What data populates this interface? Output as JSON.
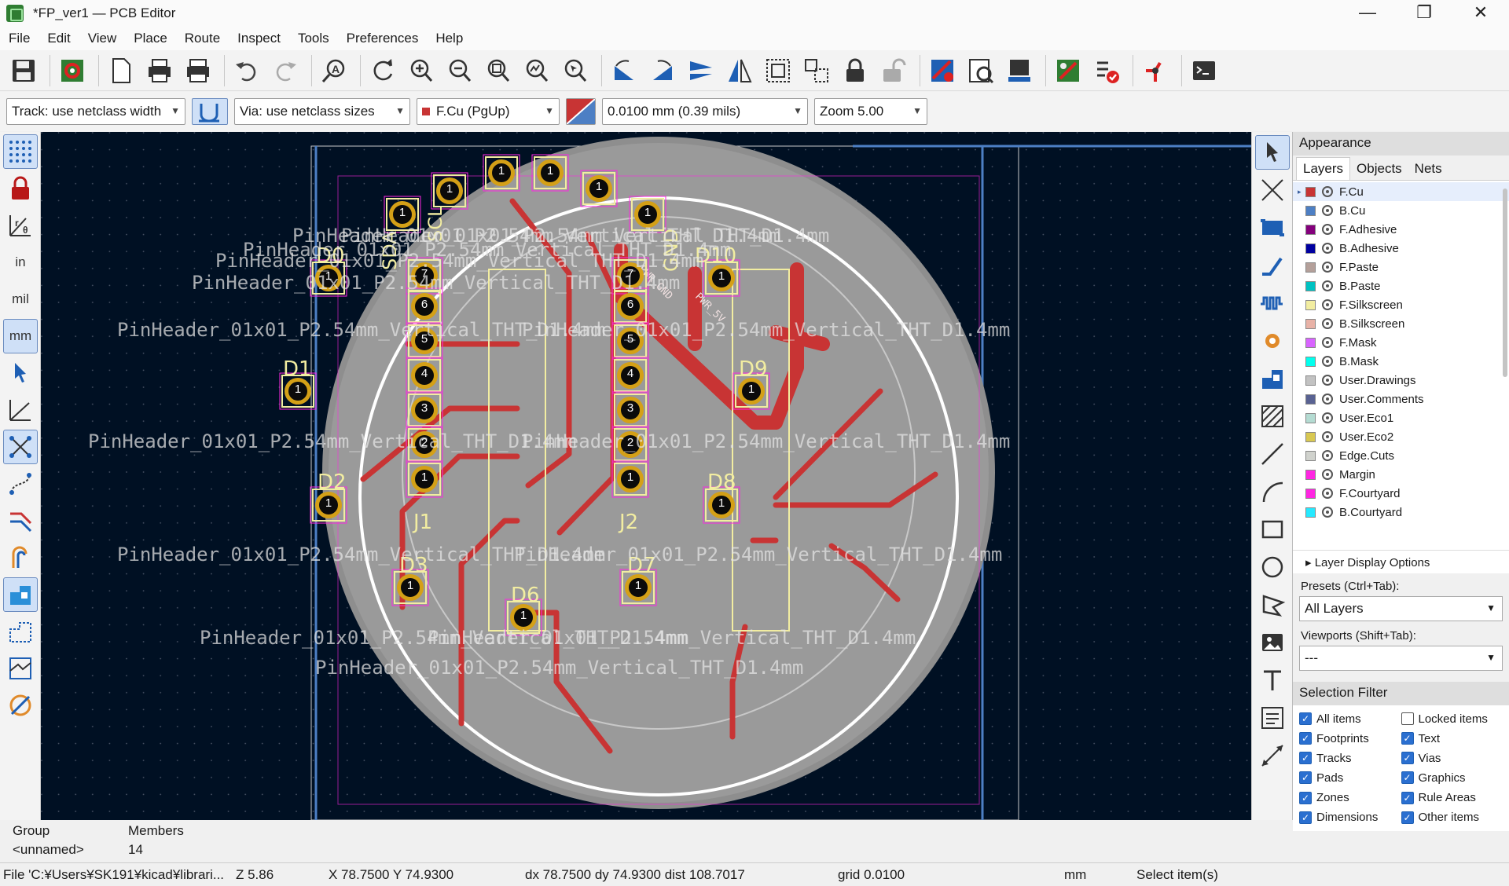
{
  "window": {
    "title": "*FP_ver1 — PCB Editor",
    "controls": [
      "—",
      "❐",
      "✕"
    ]
  },
  "menu": [
    "File",
    "Edit",
    "View",
    "Place",
    "Route",
    "Inspect",
    "Tools",
    "Preferences",
    "Help"
  ],
  "toolbar2": {
    "track": "Track: use netclass width",
    "via": "Via: use netclass sizes",
    "layer": "F.Cu (PgUp)",
    "grid": "0.0100 mm (0.39 mils)",
    "zoom": "Zoom 5.00"
  },
  "lefttools": {
    "in_label": "in",
    "mil_label": "mil",
    "mm_label": "mm"
  },
  "appearance": {
    "title": "Appearance",
    "tabs": [
      "Layers",
      "Objects",
      "Nets"
    ],
    "layers": [
      {
        "name": "F.Cu",
        "color": "#c83434"
      },
      {
        "name": "B.Cu",
        "color": "#4d7fc4"
      },
      {
        "name": "F.Adhesive",
        "color": "#84007c"
      },
      {
        "name": "B.Adhesive",
        "color": "#0000a0"
      },
      {
        "name": "F.Paste",
        "color": "#b4a09a"
      },
      {
        "name": "B.Paste",
        "color": "#00c2c2"
      },
      {
        "name": "F.Silkscreen",
        "color": "#f2eda1"
      },
      {
        "name": "B.Silkscreen",
        "color": "#e8b2a7"
      },
      {
        "name": "F.Mask",
        "color": "#d864ff"
      },
      {
        "name": "B.Mask",
        "color": "#02ffee"
      },
      {
        "name": "User.Drawings",
        "color": "#c2c2c2"
      },
      {
        "name": "User.Comments",
        "color": "#596292"
      },
      {
        "name": "User.Eco1",
        "color": "#b4dbd2"
      },
      {
        "name": "User.Eco2",
        "color": "#d8c852"
      },
      {
        "name": "Edge.Cuts",
        "color": "#d0d2cd"
      },
      {
        "name": "Margin",
        "color": "#ff26e2"
      },
      {
        "name": "F.Courtyard",
        "color": "#ff26e2"
      },
      {
        "name": "B.Courtyard",
        "color": "#26e9ff"
      }
    ],
    "layer_display_options": "Layer Display Options",
    "presets_label": "Presets (Ctrl+Tab):",
    "presets_value": "All Layers",
    "viewports_label": "Viewports (Shift+Tab):",
    "viewports_value": "---"
  },
  "selection_filter": {
    "title": "Selection Filter",
    "items": [
      {
        "label": "All items",
        "checked": true
      },
      {
        "label": "Locked items",
        "checked": false
      },
      {
        "label": "Footprints",
        "checked": true
      },
      {
        "label": "Text",
        "checked": true
      },
      {
        "label": "Tracks",
        "checked": true
      },
      {
        "label": "Vias",
        "checked": true
      },
      {
        "label": "Pads",
        "checked": true
      },
      {
        "label": "Graphics",
        "checked": true
      },
      {
        "label": "Zones",
        "checked": true
      },
      {
        "label": "Rule Areas",
        "checked": true
      },
      {
        "label": "Dimensions",
        "checked": true
      },
      {
        "label": "Other items",
        "checked": true
      }
    ]
  },
  "msgpanel": {
    "group_label": "Group",
    "group_value": "<unnamed>",
    "members_label": "Members",
    "members_value": "14"
  },
  "statusbar": {
    "file": "File 'C:¥Users¥SK191¥kicad¥librari...",
    "z": "Z 5.86",
    "xy": "X 78.7500  Y 74.9300",
    "delta": "dx 78.7500  dy 74.9300  dist 108.7017",
    "grid": "grid 0.0100",
    "units": "mm",
    "message": "Select item(s)"
  },
  "board": {
    "ref_labels": [
      "D0",
      "D1",
      "D2",
      "D3",
      "D6",
      "D7",
      "D8",
      "D9",
      "D10",
      "J1",
      "J2",
      "GND",
      "SDA",
      "SCL"
    ],
    "value_label": "PinHeader_01x01_P2.54mm_Vertical_THT_D1.4mm",
    "pad_number": "1",
    "j1_pins": [
      "7",
      "6",
      "5",
      "4",
      "3",
      "2",
      "1"
    ],
    "j2_pins": [
      "7",
      "6",
      "5",
      "4",
      "3",
      "2",
      "1"
    ],
    "net_labels": [
      "PWR_GND",
      "PWR_5V"
    ]
  }
}
